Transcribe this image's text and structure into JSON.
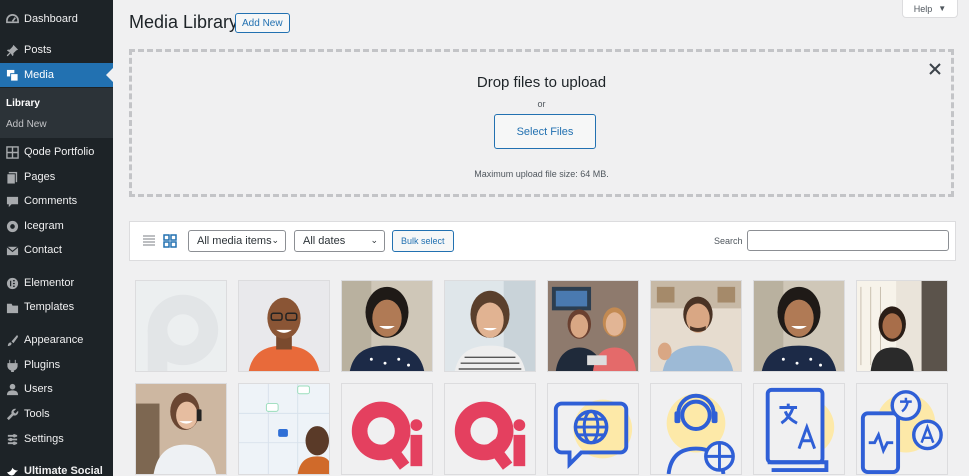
{
  "sidebar": {
    "items": [
      {
        "label": "Dashboard",
        "icon": "dashboard-icon"
      },
      {
        "label": "Posts",
        "icon": "pin-icon"
      },
      {
        "label": "Media",
        "icon": "media-icon"
      },
      {
        "label": "Qode Portfolio",
        "icon": "grid-icon"
      },
      {
        "label": "Pages",
        "icon": "pages-icon"
      },
      {
        "label": "Comments",
        "icon": "comment-icon"
      },
      {
        "label": "Icegram",
        "icon": "icegram-icon"
      },
      {
        "label": "Contact",
        "icon": "mail-icon"
      },
      {
        "label": "Elementor",
        "icon": "elementor-icon"
      },
      {
        "label": "Templates",
        "icon": "folder-icon"
      },
      {
        "label": "Appearance",
        "icon": "brush-icon"
      },
      {
        "label": "Plugins",
        "icon": "plug-icon"
      },
      {
        "label": "Users",
        "icon": "user-icon"
      },
      {
        "label": "Tools",
        "icon": "wrench-icon"
      },
      {
        "label": "Settings",
        "icon": "settings-icon"
      },
      {
        "label": "Ultimate Social",
        "icon": "bird-icon"
      }
    ],
    "submenu": [
      "Library",
      "Add New"
    ]
  },
  "header": {
    "title": "Media Library",
    "add_new": "Add New",
    "help": "Help"
  },
  "uploader": {
    "title": "Drop files to upload",
    "or": "or",
    "select_files": "Select Files",
    "max_size": "Maximum upload file size: 64 MB."
  },
  "toolbar": {
    "filter_type": "All media items",
    "filter_date": "All dates",
    "bulk_select": "Bulk select",
    "search_label": "Search",
    "search_value": ""
  },
  "colors": {
    "sidebar_bg": "#1d2327",
    "accent": "#2271b1",
    "qode_red": "#e4405f",
    "icon_blue": "#2f5fd6",
    "icon_yellow": "#fde9a8"
  },
  "grid": {
    "rows": [
      [
        "placeholder-image",
        "smiling-man-orange-shirt",
        "woman-polka-dot-blouse",
        "woman-striped-shirt",
        "two-women-office",
        "man-gesturing-desk",
        "woman-polka-dot-blouse",
        "woman-by-window"
      ],
      [
        "woman-on-phone",
        "man-with-map-pins",
        "qode-logo",
        "qode-logo",
        "globe-chat-icon",
        "support-agent-icon",
        "translate-book-icon",
        "phone-translate-icon"
      ]
    ]
  }
}
